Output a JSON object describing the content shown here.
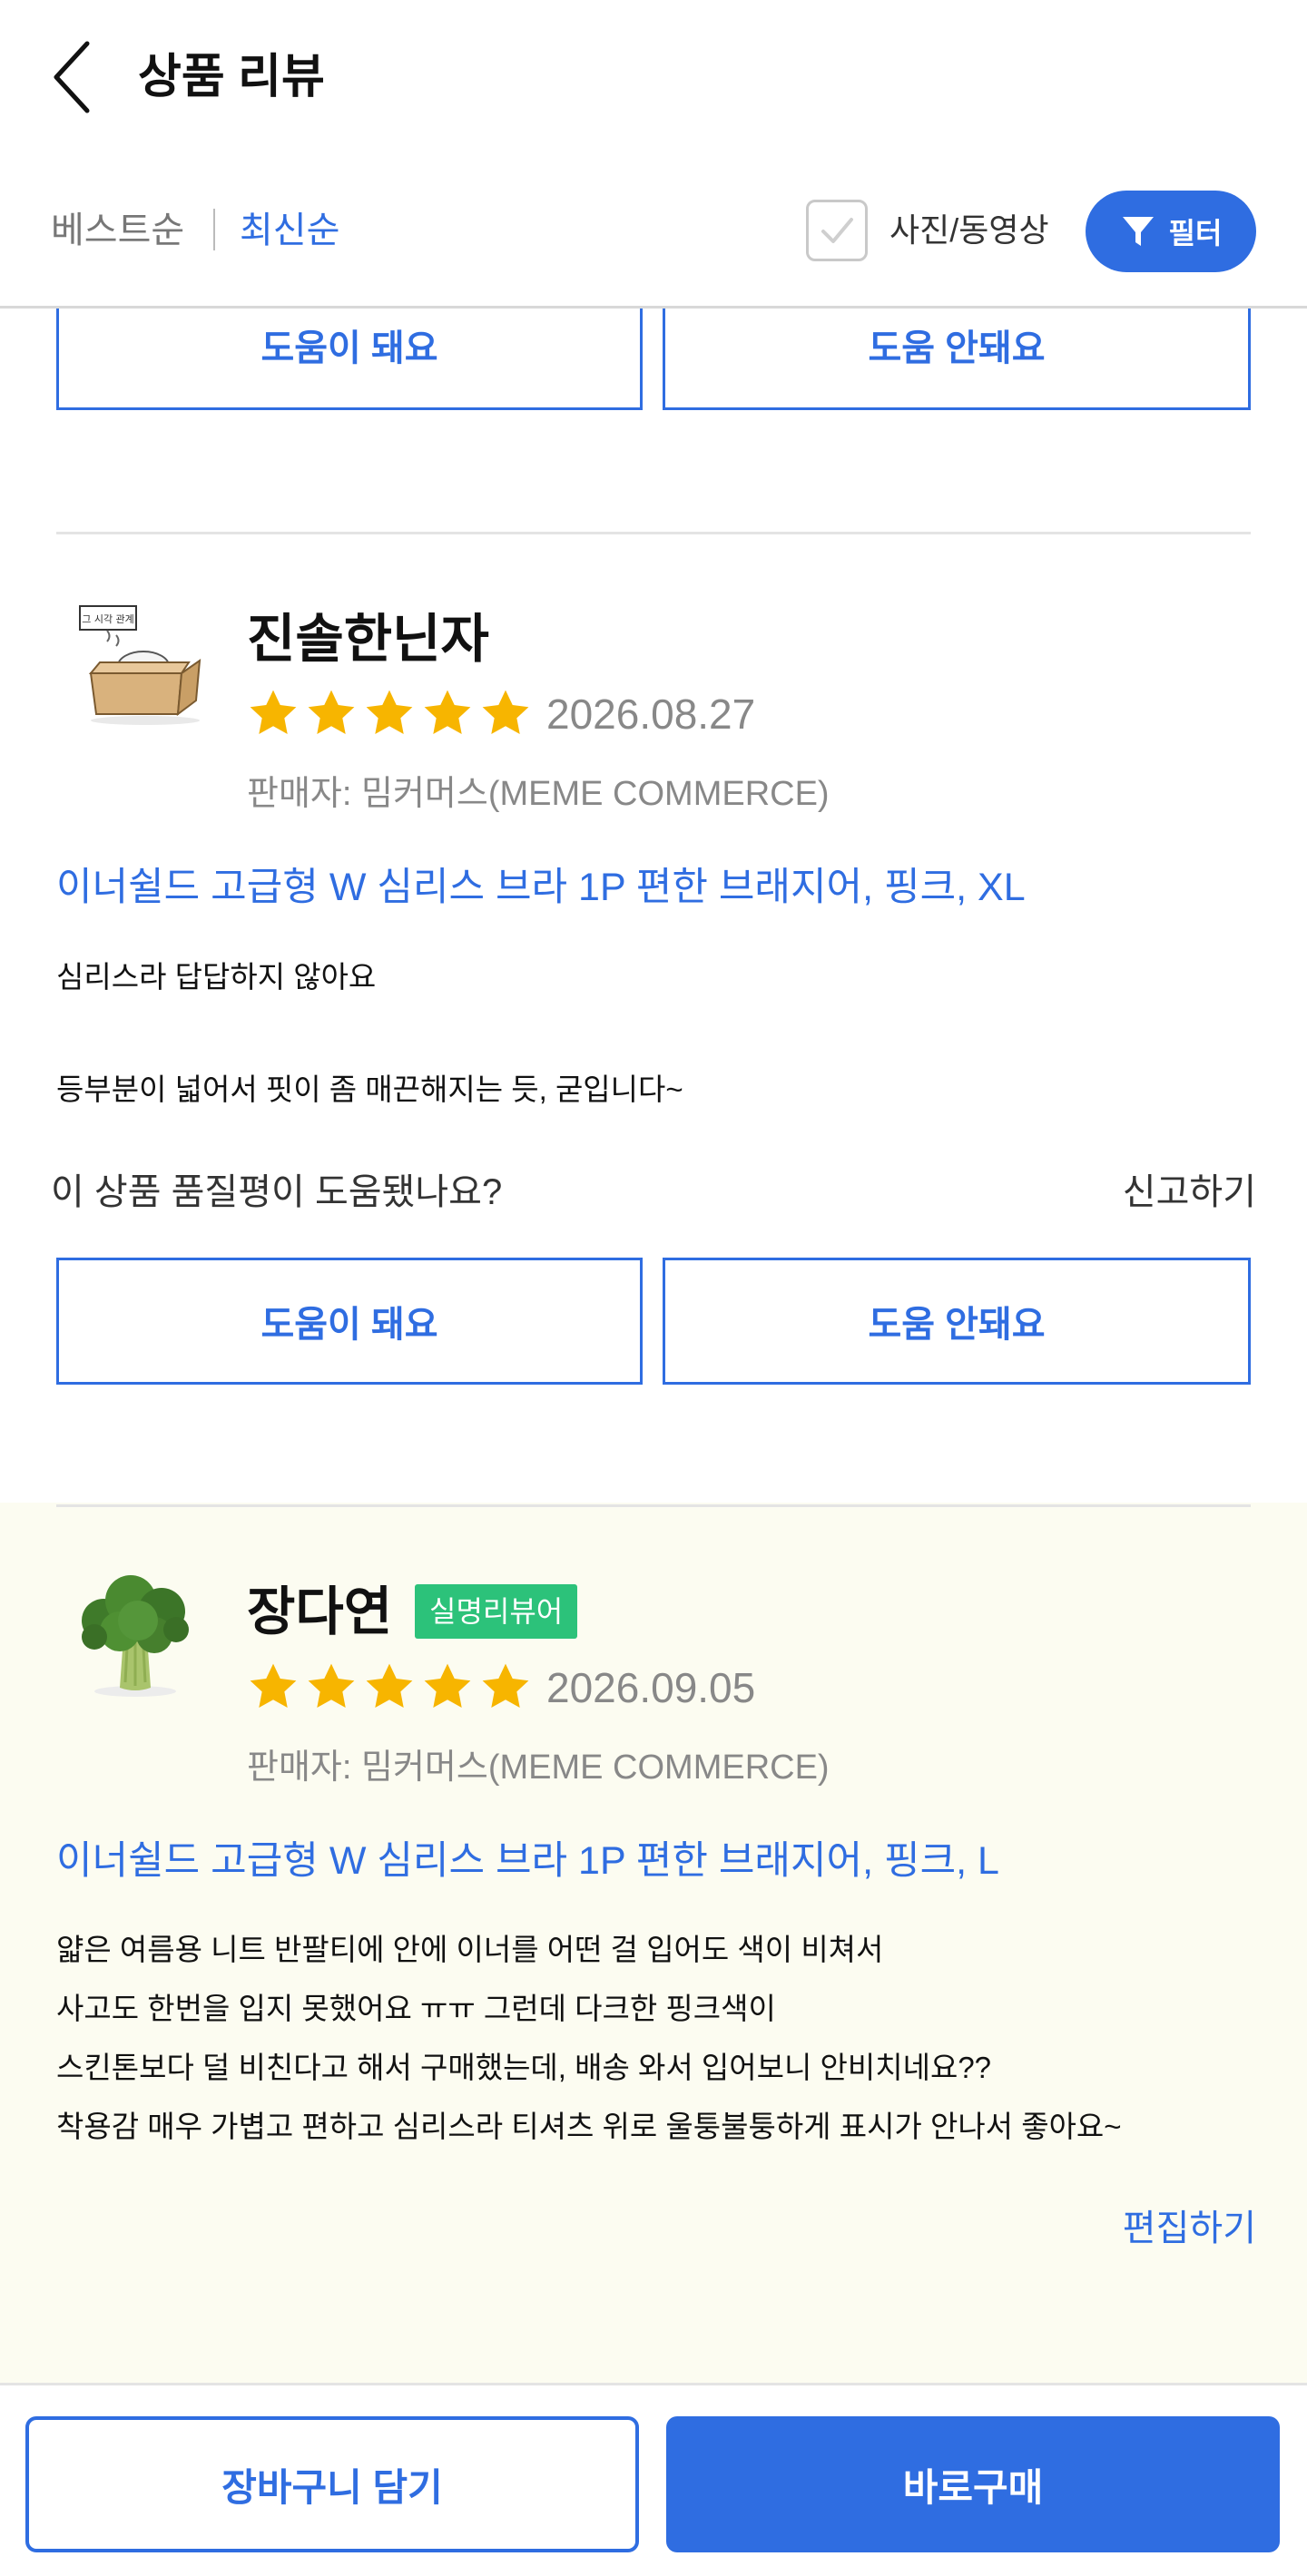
{
  "header": {
    "title": "상품 리뷰"
  },
  "sortbar": {
    "best": "베스트순",
    "newest": "최신순",
    "photo_filter": "사진/동영상",
    "filter": "필터"
  },
  "top_buttons": {
    "helpful": "도움이 돼요",
    "not_helpful": "도움 안돼요"
  },
  "reviews": [
    {
      "name": "진솔한닌자",
      "rating": 5,
      "date": "2026.08.27",
      "seller": "판매자: 밈커머스(MEME COMMERCE)",
      "product": "이너쉴드 고급형 W 심리스 브라 1P 편한 브래지어, 핑크, XL",
      "lines": [
        "심리스라 답답하지 않아요",
        "등부분이 넓어서 핏이 좀 매끈해지는 듯, 굳입니다~"
      ],
      "helpful_question": "이 상품 품질평이 도움됐나요?",
      "report": "신고하기",
      "helpful": "도움이 돼요",
      "not_helpful": "도움 안돼요",
      "avatar_icon": "box-cat-avatar",
      "avatar_sign": "그 시각 관계"
    },
    {
      "name": "장다연",
      "badge": "실명리뷰어",
      "rating": 5,
      "date": "2026.09.05",
      "seller": "판매자: 밈커머스(MEME COMMERCE)",
      "product": "이너쉴드 고급형 W 심리스 브라 1P 편한 브래지어, 핑크, L",
      "lines": [
        "얇은 여름용 니트 반팔티에 안에 이너를 어떤 걸 입어도 색이 비쳐서",
        "사고도 한번을 입지 못했어요 ㅠㅠ 그런데 다크한 핑크색이",
        "스킨톤보다 덜 비친다고 해서 구매했는데, 배송 와서 입어보니 안비치네요??",
        "착용감 매우 가볍고 편하고 심리스라 티셔츠 위로 울퉁불퉁하게  표시가 안나서 좋아요~"
      ],
      "edit": "편집하기",
      "avatar_icon": "broccoli-avatar"
    }
  ],
  "bottombar": {
    "cart": "장바구니 담기",
    "buy": "바로구매"
  },
  "colors": {
    "accent": "#2f6de1",
    "star": "#f7b500",
    "badge": "#2cc27a",
    "highlight_bg": "#fcfcf1"
  }
}
